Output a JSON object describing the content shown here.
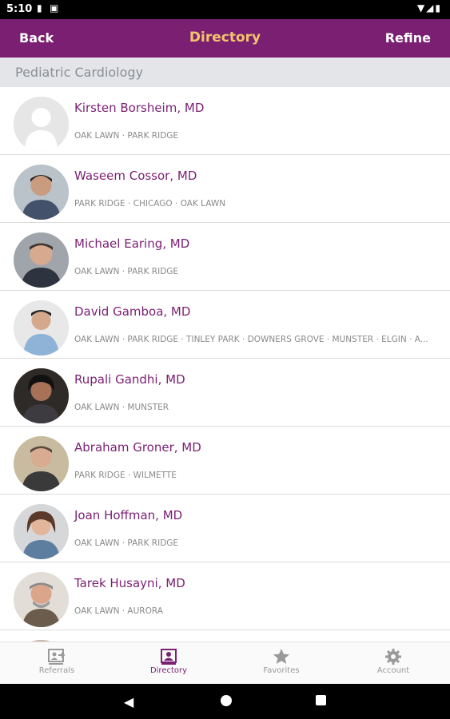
{
  "status_bar": {
    "time": "5:10"
  },
  "app_bar": {
    "back_label": "Back",
    "title": "Directory",
    "refine_label": "Refine"
  },
  "section": {
    "title": "Pediatric Cardiology"
  },
  "doctors": [
    {
      "name": "Kirsten Borsheim, MD",
      "locations": "OAK LAWN · PARK RIDGE"
    },
    {
      "name": "Waseem Cossor, MD",
      "locations": "PARK RIDGE · CHICAGO · OAK LAWN"
    },
    {
      "name": "Michael Earing, MD",
      "locations": "OAK LAWN · PARK RIDGE"
    },
    {
      "name": "David Gamboa, MD",
      "locations": "OAK LAWN · PARK RIDGE · TINLEY PARK · DOWNERS GROVE · MUNSTER · ELGIN · A..."
    },
    {
      "name": "Rupali Gandhi, MD",
      "locations": "OAK LAWN · MUNSTER"
    },
    {
      "name": "Abraham Groner, MD",
      "locations": "PARK RIDGE · WILMETTE"
    },
    {
      "name": "Joan Hoffman, MD",
      "locations": "OAK LAWN · PARK RIDGE"
    },
    {
      "name": "Tarek Husayni, MD",
      "locations": "OAK LAWN · AURORA"
    },
    {
      "name": "",
      "locations": ""
    }
  ],
  "bottom_nav": {
    "referrals": "Referrals",
    "directory": "Directory",
    "favorites": "Favorites",
    "account": "Account"
  },
  "colors": {
    "brand": "#7b1f73",
    "title_accent": "#f2c56b"
  }
}
